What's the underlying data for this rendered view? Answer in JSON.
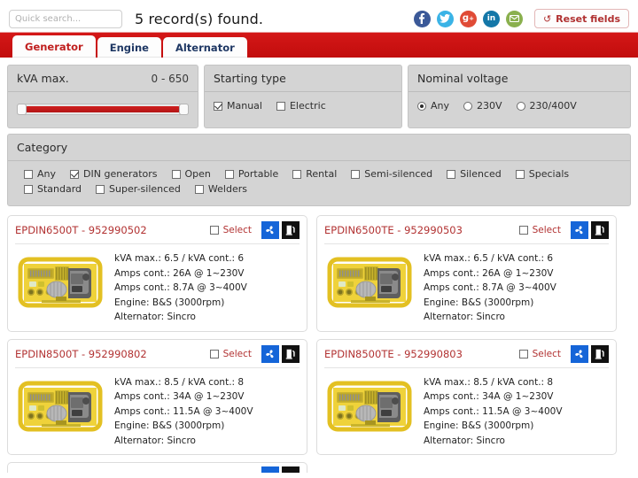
{
  "topbar": {
    "search_placeholder": "Quick search...",
    "search_value": "",
    "record_count_text": "5 record(s) found.",
    "reset_label": "Reset fields",
    "reset_icon": "refresh-icon",
    "social": [
      {
        "name": "facebook-icon",
        "glyph": "f",
        "color": "#3b5998"
      },
      {
        "name": "twitter-icon",
        "glyph": "t",
        "color": "#3ab3e6"
      },
      {
        "name": "google-plus-icon",
        "glyph": "g+",
        "color": "#e04b36"
      },
      {
        "name": "linkedin-icon",
        "glyph": "in",
        "color": "#1477a8"
      },
      {
        "name": "email-icon",
        "glyph": "@",
        "color": "#8ab04e"
      }
    ]
  },
  "tabs": [
    {
      "label": "Generator",
      "active": true
    },
    {
      "label": "Engine",
      "active": false
    },
    {
      "label": "Alternator",
      "active": false
    }
  ],
  "filters": {
    "kva": {
      "title": "kVA max.",
      "range_label": "0 - 650",
      "min": 0,
      "max": 650
    },
    "starting_type": {
      "title": "Starting type",
      "options": [
        {
          "label": "Manual",
          "checked": true
        },
        {
          "label": "Electric",
          "checked": false
        }
      ]
    },
    "nominal_voltage": {
      "title": "Nominal voltage",
      "options": [
        {
          "label": "Any",
          "checked": true
        },
        {
          "label": "230V",
          "checked": false
        },
        {
          "label": "230/400V",
          "checked": false
        }
      ]
    },
    "category": {
      "title": "Category",
      "options": [
        {
          "label": "Any",
          "checked": false
        },
        {
          "label": "DIN generators",
          "checked": true
        },
        {
          "label": "Open",
          "checked": false
        },
        {
          "label": "Portable",
          "checked": false
        },
        {
          "label": "Rental",
          "checked": false
        },
        {
          "label": "Semi-silenced",
          "checked": false
        },
        {
          "label": "Silenced",
          "checked": false
        },
        {
          "label": "Specials",
          "checked": false
        },
        {
          "label": "Standard",
          "checked": false
        },
        {
          "label": "Super-silenced",
          "checked": false
        },
        {
          "label": "Welders",
          "checked": false
        }
      ]
    }
  },
  "results": {
    "select_label": "Select",
    "cards": [
      {
        "title": "EPDIN6500T - 952990502",
        "selected": false,
        "badges": [
          "fan-icon",
          "fuel-pump-icon"
        ],
        "specs": [
          "kVA max.: 6.5 / kVA cont.: 6",
          "Amps cont.: 26A @ 1~230V",
          "Amps cont.: 8.7A @ 3~400V",
          "Engine: B&S (3000rpm)",
          "Alternator: Sincro"
        ]
      },
      {
        "title": "EPDIN6500TE - 952990503",
        "selected": false,
        "badges": [
          "fan-icon",
          "fuel-pump-icon"
        ],
        "specs": [
          "kVA max.: 6.5 / kVA cont.: 6",
          "Amps cont.: 26A @ 1~230V",
          "Amps cont.: 8.7A @ 3~400V",
          "Engine: B&S (3000rpm)",
          "Alternator: Sincro"
        ]
      },
      {
        "title": "EPDIN8500T - 952990802",
        "selected": false,
        "badges": [
          "fan-icon",
          "fuel-pump-icon"
        ],
        "specs": [
          "kVA max.: 8.5 / kVA cont.: 8",
          "Amps cont.: 34A @ 1~230V",
          "Amps cont.: 11.5A @ 3~400V",
          "Engine: B&S (3000rpm)",
          "Alternator: Sincro"
        ]
      },
      {
        "title": "EPDIN8500TE - 952990803",
        "selected": false,
        "badges": [
          "fan-icon",
          "fuel-pump-icon"
        ],
        "specs": [
          "kVA max.: 8.5 / kVA cont.: 8",
          "Amps cont.: 34A @ 1~230V",
          "Amps cont.: 11.5A @ 3~400V",
          "Engine: B&S (3000rpm)",
          "Alternator: Sincro"
        ]
      }
    ]
  },
  "colors": {
    "brand_red": "#c20d0d",
    "title_red": "#b23232",
    "tab_text": "#1f3864",
    "panel_bg": "#d4d4d4",
    "badge_fan": "#1565d8",
    "badge_fuel": "#111111"
  }
}
